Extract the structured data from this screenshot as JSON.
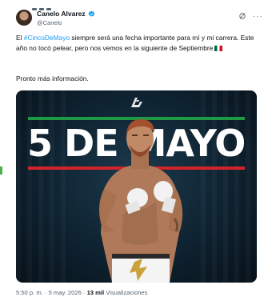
{
  "tweet": {
    "author": {
      "name": "Canelo Alvarez",
      "handle": "@Canelo"
    },
    "text": {
      "before_hashtag": "El ",
      "hashtag": "#CincoDeMayo",
      "after_hashtag": " siempre será una fecha importante para mí y mi carrera. Este año no tocó pelear, pero nos vemos en la siguiente de Septiembre",
      "line2": "Pronto más información."
    },
    "media": {
      "headline": "5 DE MAYO"
    },
    "meta": {
      "time": "5:50 p. m.",
      "separator": "·",
      "date": "5 may. 2026",
      "views_count": "13 mil",
      "views_label": "Visualizaciones"
    }
  },
  "icons": {
    "verified": "verified-badge-icon",
    "grok": "grok-icon",
    "more": "more-icon",
    "flag": "mexico-flag-icon",
    "logo": "canelo-logo-icon"
  },
  "colors": {
    "accent": "#1d9bf0",
    "muted": "#536471",
    "stripe_green": "#1e9a45",
    "stripe_red": "#d2232a"
  }
}
